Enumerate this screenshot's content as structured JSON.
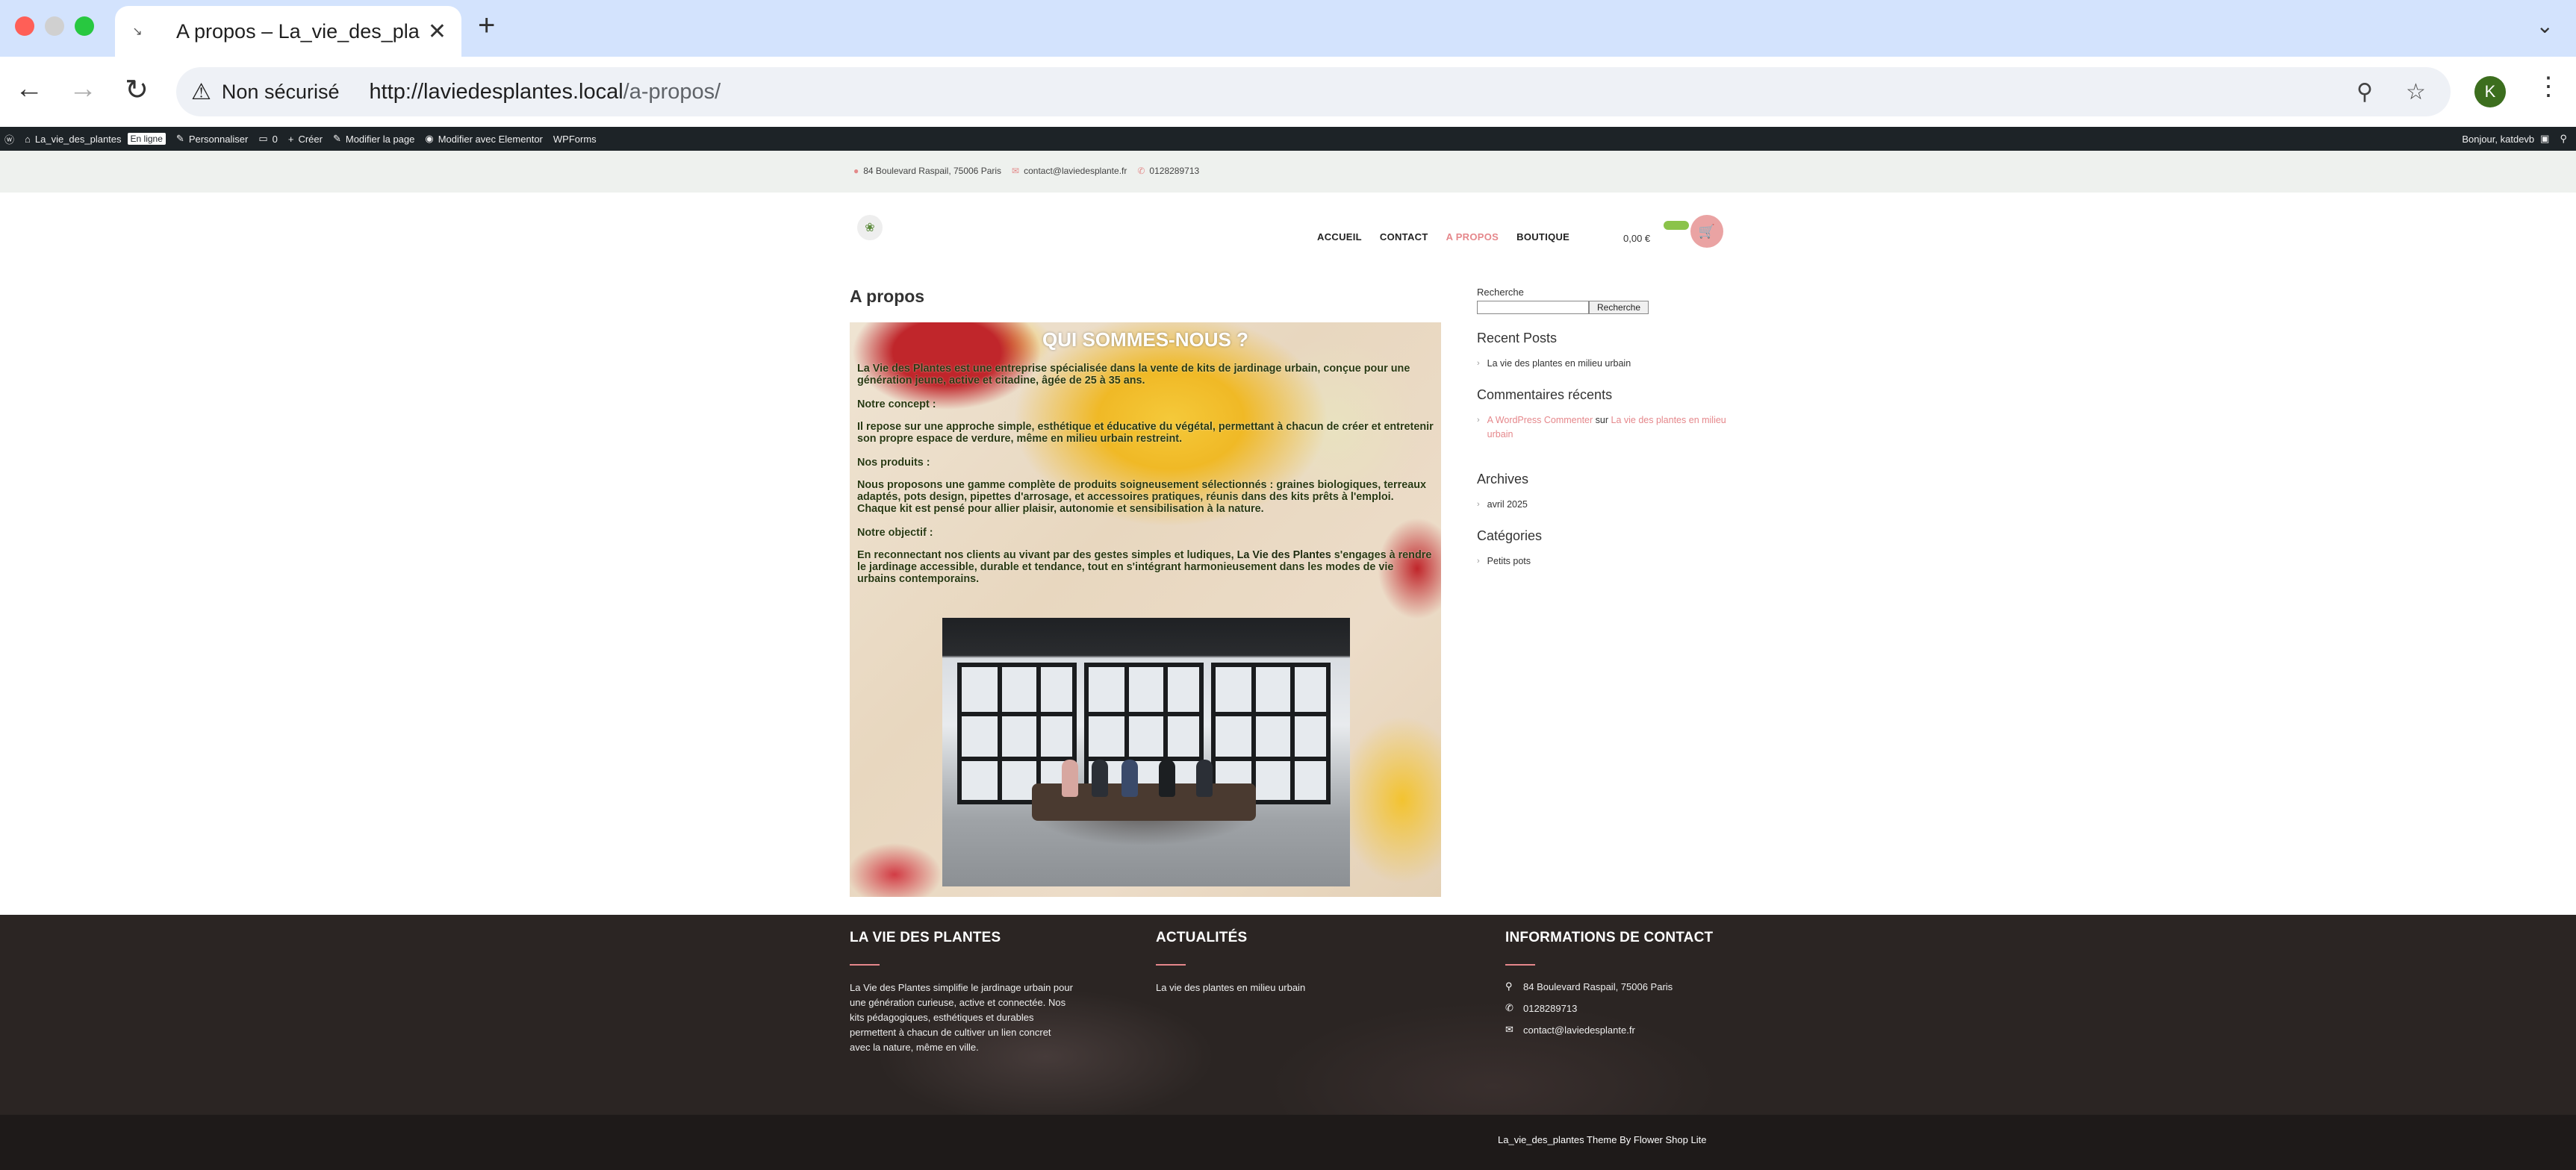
{
  "browser": {
    "tab_title": "A propos – La_vie_des_plantes",
    "security_label": "Non sécurisé",
    "url_host": "http://laviedesplantes.local",
    "url_path": "/a-propos/",
    "avatar_letter": "K"
  },
  "wp_admin_bar": {
    "site_name": "La_vie_des_plantes",
    "status_badge": "En ligne",
    "customize": "Personnaliser",
    "comments_count": "0",
    "new": "Créer",
    "edit_page": "Modifier la page",
    "edit_elementor": "Modifier avec Elementor",
    "wpforms": "WPForms",
    "greeting": "Bonjour, katdevb"
  },
  "top_info": {
    "address": "84 Boulevard Raspail, 75006 Paris",
    "email": "contact@laviedesplante.fr",
    "phone": "0128289713"
  },
  "nav": {
    "items": [
      "ACCUEIL",
      "CONTACT",
      "A PROPOS",
      "BOUTIQUE"
    ],
    "active_index": 2,
    "cart_total": "0,00 €"
  },
  "page": {
    "title": "A propos",
    "hero_title": "QUI SOMMES-NOUS ?",
    "intro": "La Vie des Plantes est une entreprise spécialisée dans la vente de kits de jardinage urbain, conçue pour une génération jeune, active et citadine, âgée de 25 à 35 ans.",
    "concept_label": "Notre concept :",
    "concept_text": "Il repose sur une approche simple, esthétique et éducative du végétal, permettant à chacun de créer et entretenir son propre espace de verdure, même en milieu urbain restreint.",
    "products_label": "Nos produits :",
    "products_text": "Nous proposons une gamme complète de produits soigneusement sélectionnés : graines biologiques, terreaux adaptés, pots design, pipettes d'arrosage, et accessoires pratiques, réunis dans des kits prêts à l'emploi.",
    "products_text2": "Chaque kit est pensé pour allier plaisir, autonomie et sensibilisation à la nature.",
    "objective_label": "Notre objectif :",
    "objective_text_a": "En reconnectant nos clients au vivant par des gestes simples et ludiques, ",
    "objective_brand": "La Vie des Plantes",
    "objective_text_b": " s'engages à rendre le jardinage accessible, durable et tendance, tout en s'intégrant harmonieusement dans les modes de vie urbains contemporains."
  },
  "sidebar": {
    "search_label": "Recherche",
    "search_button": "Recherche",
    "recent_posts_title": "Recent Posts",
    "recent_posts": [
      "La vie des plantes en milieu urbain"
    ],
    "recent_comments_title": "Commentaires récents",
    "comment_author": "A WordPress Commenter",
    "comment_on": "sur",
    "comment_post": "La vie des plantes en milieu urbain",
    "archives_title": "Archives",
    "archives": [
      "avril 2025"
    ],
    "categories_title": "Catégories",
    "categories": [
      "Petits pots"
    ]
  },
  "footer": {
    "col1_title": "LA VIE DES PLANTES",
    "col1_text": "La Vie des Plantes simplifie le jardinage urbain pour une génération curieuse, active et connectée. Nos kits pédagogiques, esthétiques et durables permettent à chacun de cultiver un lien concret avec la nature, même en ville.",
    "col2_title": "ACTUALITÉS",
    "col2_link": "La vie des plantes en milieu urbain",
    "col3_title": "INFORMATIONS DE CONTACT",
    "address": "84 Boulevard Raspail, 75006 Paris",
    "phone": "0128289713",
    "email": "contact@laviedesplante.fr",
    "credit": "La_vie_des_plantes Theme By Flower Shop Lite"
  },
  "colors": {
    "accent": "#e5878b",
    "footer_bg": "#2b2523",
    "admin_bar": "#1d2327"
  }
}
